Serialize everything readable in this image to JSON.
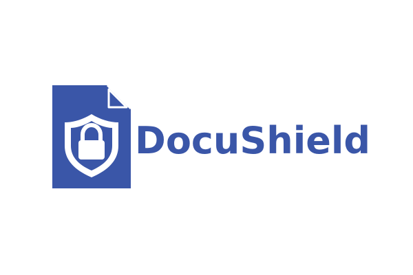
{
  "logo": {
    "brand_name": "DocuShield",
    "icon": "document-shield-lock-icon",
    "colors": {
      "brand_blue": "#3a56a8",
      "background": "#ffffff"
    }
  }
}
